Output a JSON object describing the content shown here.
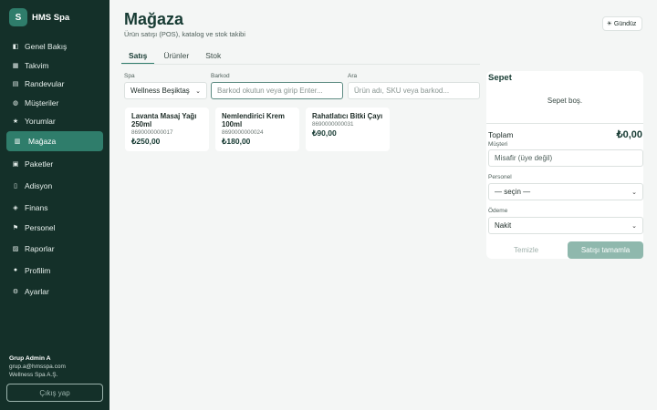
{
  "brand": {
    "logo_letter": "S",
    "name": "HMS Spa"
  },
  "sidebar": {
    "items": [
      {
        "icon": "grid-icon",
        "glyph": "◧",
        "label": "Genel Bakış"
      },
      {
        "icon": "calendar-icon",
        "glyph": "▦",
        "label": "Takvim"
      },
      {
        "icon": "appointments-icon",
        "glyph": "▤",
        "label": "Randevular"
      },
      {
        "icon": "customers-icon",
        "glyph": "◍",
        "label": "Müşteriler"
      },
      {
        "icon": "star-icon",
        "glyph": "★",
        "label": "Yorumlar"
      },
      {
        "icon": "store-icon",
        "glyph": "▥",
        "label": "Mağaza"
      },
      {
        "icon": "package-icon",
        "glyph": "▣",
        "label": "Paketler"
      },
      {
        "icon": "receipt-icon",
        "glyph": "▯",
        "label": "Adisyon"
      },
      {
        "icon": "money-bag-icon",
        "glyph": "◈",
        "label": "Finans"
      },
      {
        "icon": "staff-icon",
        "glyph": "⚑",
        "label": "Personel"
      },
      {
        "icon": "chart-icon",
        "glyph": "▨",
        "label": "Raporlar"
      },
      {
        "icon": "profile-icon",
        "glyph": "●",
        "label": "Profilim"
      },
      {
        "icon": "settings-icon",
        "glyph": "⚙",
        "label": "Ayarlar"
      }
    ],
    "active_index": 5
  },
  "user": {
    "name": "Grup Admin A",
    "email": "grup.a@hmsspa.com",
    "company": "Wellness Spa A.Ş.",
    "logout_label": "Çıkış yap"
  },
  "header": {
    "title": "Mağaza",
    "subtitle": "Ürün satışı (POS), katalog ve stok takibi",
    "theme_icon": "sun-icon",
    "theme_label": "Gündüz"
  },
  "tabs": [
    {
      "label": "Satış",
      "active": true
    },
    {
      "label": "Ürünler",
      "active": false
    },
    {
      "label": "Stok",
      "active": false
    }
  ],
  "filters": {
    "spa_label": "Spa",
    "spa_value": "Wellness Beşiktaş",
    "barcode_label": "Barkod",
    "barcode_placeholder": "Barkod okutun veya girip Enter...",
    "search_label": "Ara",
    "search_placeholder": "Ürün adı, SKU veya barkod..."
  },
  "products": [
    {
      "name": "Lavanta Masaj Yağı 250ml",
      "code": "8690000000017",
      "price": "₺250,00"
    },
    {
      "name": "Nemlendirici Krem 100ml",
      "code": "8690000000024",
      "price": "₺180,00"
    },
    {
      "name": "Rahatlatıcı Bitki Çayı",
      "code": "8690000000031",
      "price": "₺90,00"
    }
  ],
  "cart": {
    "title": "Sepet",
    "empty_text": "Sepet boş.",
    "total_label": "Toplam",
    "total_value": "₺0,00",
    "customer_label": "Müşteri",
    "customer_placeholder": "Misafir (üye değil)",
    "staff_label": "Personel",
    "staff_value": "— seçin —",
    "payment_label": "Ödeme",
    "payment_value": "Nakit",
    "clear_label": "Temizle",
    "complete_label": "Satışı tamamla"
  },
  "colors": {
    "sidebar_bg": "#143029",
    "accent": "#2f7d6b",
    "complete_button": "#8fb8ad"
  }
}
